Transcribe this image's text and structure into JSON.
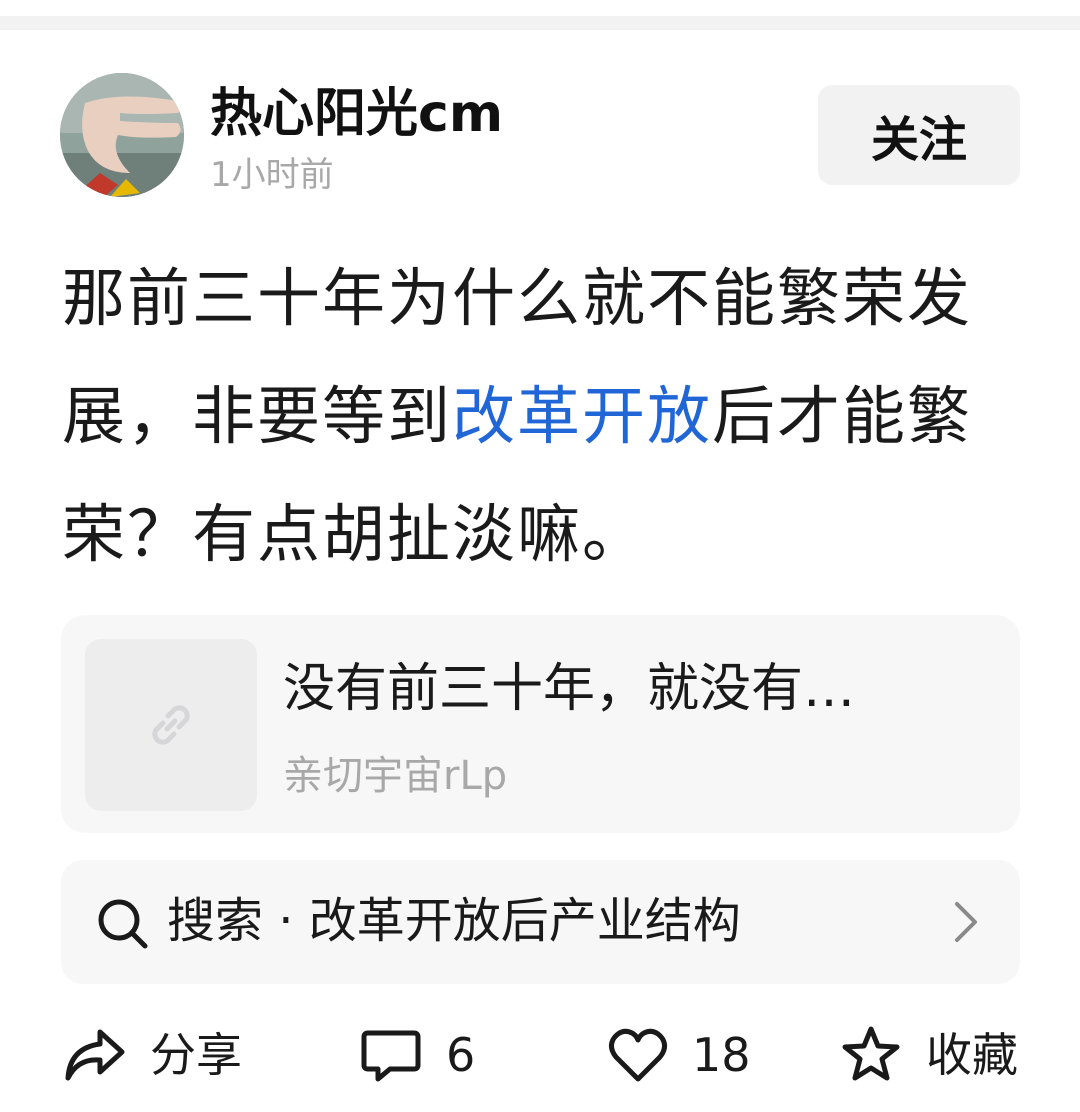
{
  "post": {
    "author": "热心阳光cm",
    "time": "1小时前",
    "follow_label": "关注",
    "body_before": "那前三十年为什么就不能繁荣发展，非要等到",
    "body_link": "改革开放",
    "body_after": "后才能繁荣？有点胡扯淡嘛。"
  },
  "link_card": {
    "title": "没有前三十年，就没有…",
    "source": "亲切宇宙rLp",
    "icon": "link-icon"
  },
  "search": {
    "text": "搜索 · 改革开放后产业结构",
    "icon": "search-icon"
  },
  "actions": {
    "share_label": "分享",
    "comment_count": "6",
    "like_count": "18",
    "favorite_label": "收藏"
  },
  "colors": {
    "link": "#2066d6",
    "muted": "#a8a8a8",
    "card_bg": "#f7f7f8",
    "button_bg": "#f2f2f3"
  }
}
